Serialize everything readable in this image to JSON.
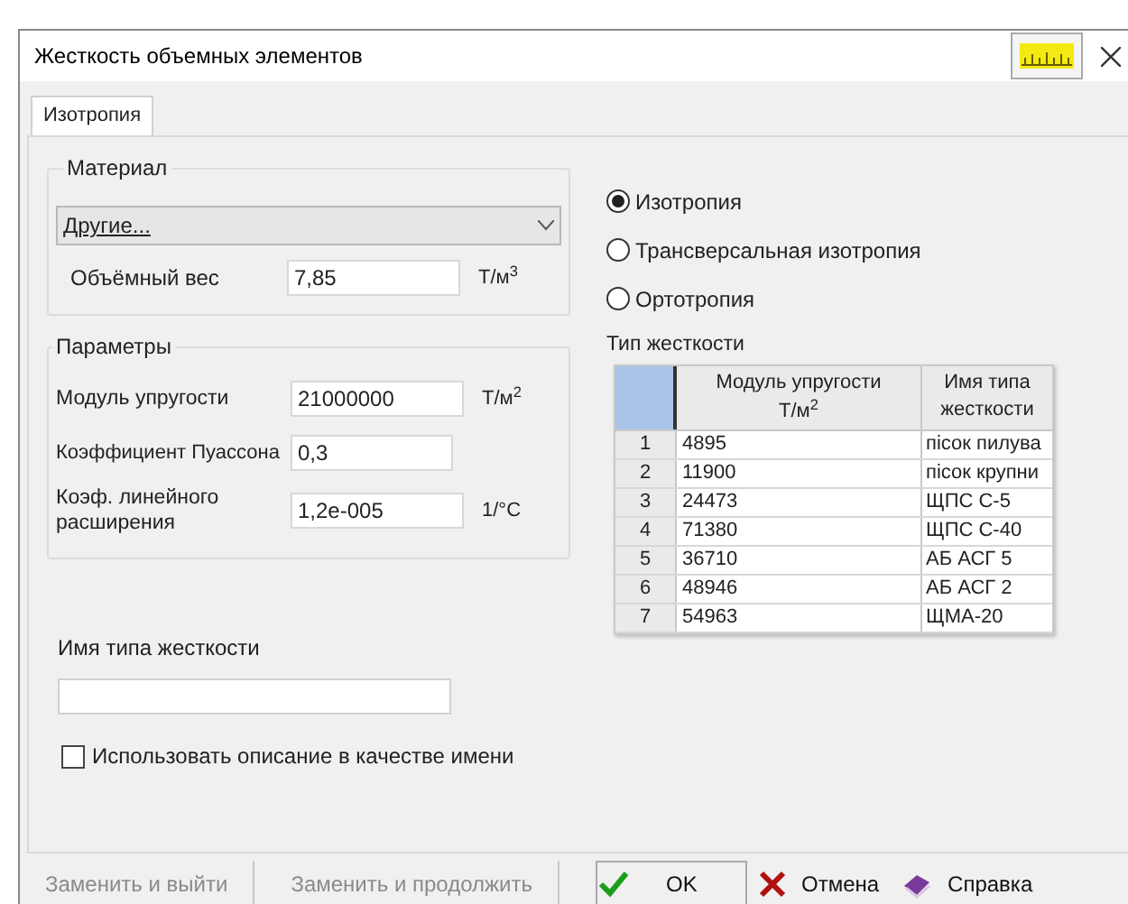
{
  "window": {
    "title": "Жесткость объемных элементов"
  },
  "tabs": [
    {
      "label": "Изотропия",
      "selected": true
    }
  ],
  "material": {
    "title": "Материал",
    "dropdown": "Другие...",
    "weight_label": "Объёмный вес",
    "weight_value": "7,85",
    "weight_unit": "Т/м$^{3}$"
  },
  "parameters": {
    "title": "Параметры",
    "fields": [
      {
        "label": "Модуль упругости",
        "value": "21000000",
        "unit": "Т/м$^{2}$"
      },
      {
        "label": "Коэффициент Пуассона",
        "value": "0,3"
      },
      {
        "label": "Коэф. линейного расширения",
        "value": "1,2e-005",
        "unit": "1/°C"
      }
    ]
  },
  "stiffness_name": {
    "label": "Имя типа жесткости"
  },
  "use_description": {
    "label": "Использовать описание в качестве имени",
    "checked": false
  },
  "radios": [
    {
      "label": "Изотропия",
      "selected": true
    },
    {
      "label": "Трансверсальная изотропия",
      "selected": false
    },
    {
      "label": "Ортотропия",
      "selected": false
    }
  ],
  "table": {
    "title": "Тип жесткости",
    "columns": [
      "",
      "Модуль упругости Т/м$^{2}$",
      "Имя типа жесткости"
    ],
    "rows": [
      [
        "1",
        "4895",
        "пісок пилува"
      ],
      [
        "2",
        "11900",
        "пісок крупни"
      ],
      [
        "3",
        "24473",
        "ЩПС С-5"
      ],
      [
        "4",
        "71380",
        "ЩПС С-40"
      ],
      [
        "5",
        "36710",
        "АБ АСГ 5"
      ],
      [
        "6",
        "48946",
        "АБ АСГ 2"
      ],
      [
        "7",
        "54963",
        "ЩМА-20"
      ]
    ]
  },
  "buttons": [
    {
      "label": "Заменить и выйти",
      "kind": "plain",
      "disabled": true
    },
    {
      "label": "Заменить и продолжить",
      "kind": "plain",
      "disabled": true
    },
    {
      "label": "OK",
      "kind": "ok",
      "disabled": false
    },
    {
      "label": "Отмена",
      "kind": "cancel",
      "disabled": false
    },
    {
      "label": "Справка",
      "kind": "help",
      "disabled": false
    }
  ]
}
